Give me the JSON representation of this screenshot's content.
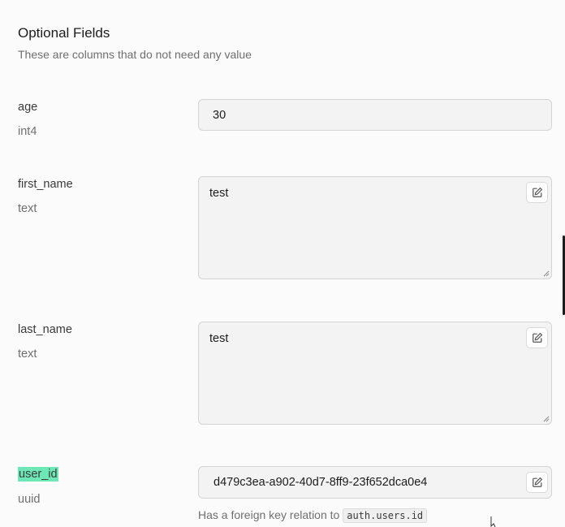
{
  "section": {
    "title": "Optional Fields",
    "subtitle": "These are columns that do not need any value"
  },
  "fields": {
    "age": {
      "name": "age",
      "type": "int4",
      "value": "30"
    },
    "first_name": {
      "name": "first_name",
      "type": "text",
      "value": "test"
    },
    "last_name": {
      "name": "last_name",
      "type": "text",
      "value": "test"
    },
    "user_id": {
      "name": "user_id",
      "type": "uuid",
      "value": "d479c3ea-a902-40d7-8ff9-23f652dca0e4",
      "fk_prefix": "Has a foreign key relation to",
      "fk_target": "auth.users.id"
    }
  },
  "icons": {
    "edit": "edit-icon",
    "resize": "resize-grip-icon",
    "cursor": "mouse-cursor-icon"
  },
  "colors": {
    "highlight": "#6ee7b7",
    "input_bg": "#f3f3f3",
    "border": "#d4d4d4"
  }
}
